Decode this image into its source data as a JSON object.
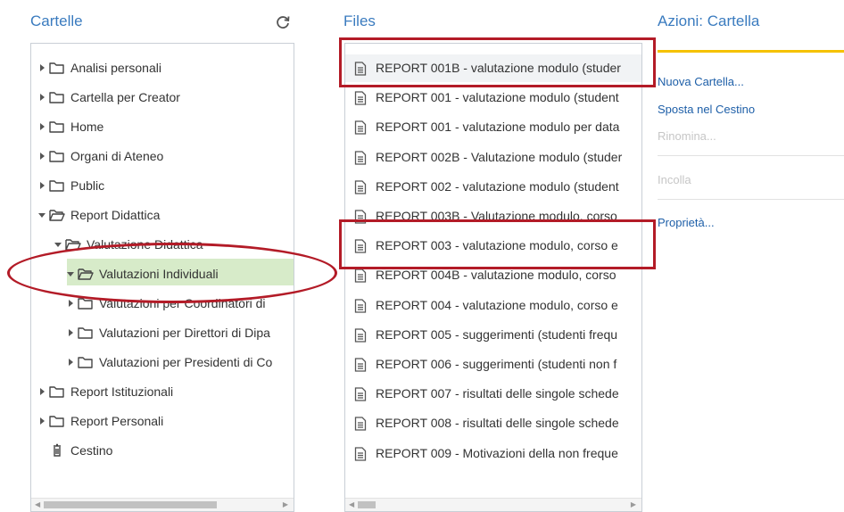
{
  "columns": {
    "folders_title": "Cartelle",
    "files_title": "Files",
    "actions_title": "Azioni: Cartella"
  },
  "folders": [
    {
      "label": "Analisi personali",
      "state": "collapsed"
    },
    {
      "label": "Cartella per Creator",
      "state": "collapsed"
    },
    {
      "label": "Home",
      "state": "collapsed"
    },
    {
      "label": "Organi di Ateneo",
      "state": "collapsed"
    },
    {
      "label": "Public",
      "state": "collapsed"
    },
    {
      "label": "Report Didattica",
      "state": "expanded"
    },
    {
      "label": "Valutazione Didattica",
      "state": "expanded"
    },
    {
      "label": "Valutazioni Individuali",
      "state": "expanded",
      "selected": true
    },
    {
      "label": "Valutazioni per Coordinatori di",
      "state": "collapsed"
    },
    {
      "label": "Valutazioni per Direttori di Dipa",
      "state": "collapsed"
    },
    {
      "label": "Valutazioni per Presidenti di Co",
      "state": "collapsed"
    },
    {
      "label": "Report Istituzionali",
      "state": "collapsed"
    },
    {
      "label": "Report Personali",
      "state": "collapsed"
    },
    {
      "label": "Cestino",
      "state": "trash"
    }
  ],
  "files": [
    "REPORT 001B - valutazione modulo (studer",
    "REPORT 001 - valutazione modulo (student",
    "REPORT 001 - valutazione modulo per data",
    "REPORT 002B - Valutazione modulo (studer",
    "REPORT 002 - valutazione modulo (student",
    "REPORT 003B - Valutazione modulo, corso",
    "REPORT 003 - valutazione modulo, corso e",
    "REPORT 004B - valutazione modulo, corso",
    "REPORT 004 - valutazione modulo, corso e",
    "REPORT 005 - suggerimenti (studenti frequ",
    "REPORT 006 - suggerimenti (studenti non f",
    "REPORT 007 - risultati delle singole schede",
    "REPORT 008 - risultati delle singole schede",
    "REPORT 009 - Motivazioni della non freque"
  ],
  "actions": {
    "new_folder": "Nuova Cartella...",
    "move_trash": "Sposta nel Cestino",
    "rename": "Rinomina...",
    "paste": "Incolla",
    "properties": "Proprietà..."
  },
  "colors": {
    "accent_blue": "#3a7bbf",
    "link_blue": "#1e5fa8",
    "selection_green": "#d7ebc9",
    "highlight_red": "#b31b27",
    "actions_bar_yellow": "#f5c200"
  },
  "icons": {
    "refresh": "refresh-icon",
    "folder": "folder-icon",
    "folder_open": "folder-open-icon",
    "document": "document-icon",
    "trash": "trash-icon"
  }
}
